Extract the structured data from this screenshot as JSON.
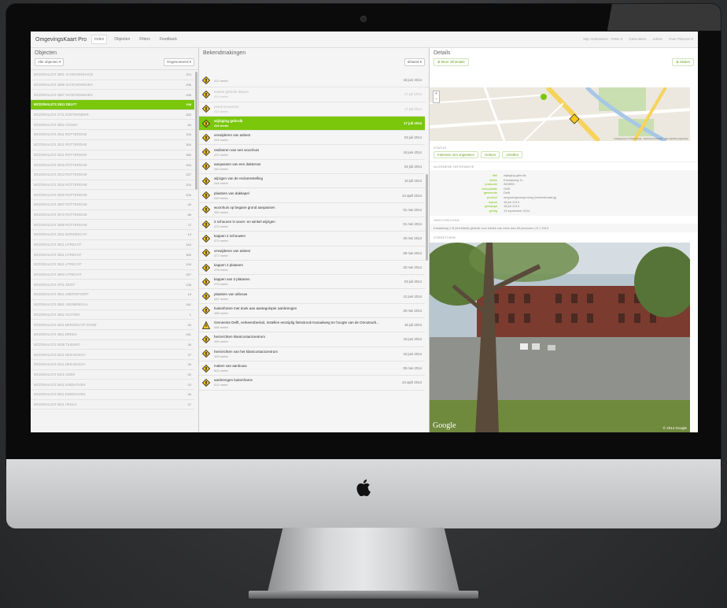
{
  "app": {
    "brand": "OmgevingsKaart Pro",
    "nav": [
      "Index",
      "Objecten",
      "Filters",
      "Feedback"
    ],
    "nav_right": [
      "Mijn Gebruikers · Peter ▾",
      "Gebruikers",
      "Admin",
      "Over Plannen ▾"
    ]
  },
  "objects": {
    "title": "Objecten",
    "filter_label": "Alle objecten ▾",
    "sort_label": "Ongesorteerd ▾",
    "items": [
      {
        "name": "MCDONALD'S 2801 'S-GRAVENHAGE",
        "count": "374"
      },
      {
        "name": "MCDONALD'S 4388 SCHEVENINGEN",
        "count": "296"
      },
      {
        "name": "MCDONALD'S 2587 SCHEVENINGEN",
        "count": "248"
      },
      {
        "name": "MCDONALD'S 2611 DELFT",
        "count": "198",
        "selected": true
      },
      {
        "name": "MCDONALD'S 2711 ZOETERMEER",
        "count": "283"
      },
      {
        "name": "MCDONALD'S 2861 GOUDA",
        "count": "84"
      },
      {
        "name": "MCDONALD'S 3011 ROTTERDAM",
        "count": "194"
      },
      {
        "name": "MCDONALD'S 3011 ROTTERDAM",
        "count": "304"
      },
      {
        "name": "MCDONALD'S 3011 ROTTERDAM",
        "count": "289"
      },
      {
        "name": "MCDONALD'S 3015 ROTTERDAM",
        "count": "154"
      },
      {
        "name": "MCDONALD'S 3013 ROTTERDAM",
        "count": "227"
      },
      {
        "name": "MCDONALD'S 3016 ROTTERDAM",
        "count": "224"
      },
      {
        "name": "MCDONALD'S 3026 ROTTERDAM",
        "count": "226"
      },
      {
        "name": "MCDONALD'S 3087 ROTTERDAM",
        "count": "45"
      },
      {
        "name": "MCDONALD'S 3072 ROTTERDAM",
        "count": "88"
      },
      {
        "name": "MCDONALD'S 3089 ROTTERDAM",
        "count": "72"
      },
      {
        "name": "MCDONALD'S 3311 DORDRECHT",
        "count": "19"
      },
      {
        "name": "MCDONALD'S 3511 UTRECHT",
        "count": "164"
      },
      {
        "name": "MCDONALD'S 3511 UTRECHT",
        "count": "300"
      },
      {
        "name": "MCDONALD'S 3511 UTRECHT",
        "count": "194"
      },
      {
        "name": "MCDONALD'S 3562 UTRECHT",
        "count": "157"
      },
      {
        "name": "MCDONALD'S 3701 ZEIST",
        "count": "136"
      },
      {
        "name": "MCDONALD'S 3811 AMERSFOORT",
        "count": "19"
      },
      {
        "name": "MCDONALD'S 3861 VEENENDAAL",
        "count": "161"
      },
      {
        "name": "MCDONALD'S 4061 OCHTEN",
        "count": "1"
      },
      {
        "name": "MCDONALD'S 4611 BERGEN OP ZOOM",
        "count": "40"
      },
      {
        "name": "MCDONALD'S 4811 BREDA",
        "count": "241"
      },
      {
        "name": "MCDONALD'S 5038 TILBURG",
        "count": "39"
      },
      {
        "name": "MCDONALD'S 5211 DEN BOSCH",
        "count": "37"
      },
      {
        "name": "MCDONALD'S 5211 DEN BOSCH",
        "count": "30"
      },
      {
        "name": "MCDONALD'S 5401 UDEN",
        "count": "32"
      },
      {
        "name": "MCDONALD'S 5611 EINDHOVEN",
        "count": "22"
      },
      {
        "name": "MCDONALD'S 5611 EINDHOVEN",
        "count": "30"
      },
      {
        "name": "MCDONALD'S 5611 VENLO",
        "count": "27"
      }
    ]
  },
  "events": {
    "title": "Bekendmakingen",
    "sort_label": "afstand ▾",
    "items": [
      {
        "title": "",
        "dist": "412 meter",
        "date": "18 juni 2014"
      },
      {
        "title": "inantie gebruik diepen",
        "dist": "414 meter",
        "date": "17 juli 2014",
        "faded": true
      },
      {
        "title": "pand renoveren",
        "dist": "414 meter",
        "date": "17 juli 2014",
        "faded": true
      },
      {
        "title": "wijziging gebruik",
        "dist": "416 meter",
        "date": "17 juli 2014",
        "selected": true
      },
      {
        "title": "verwijderen van asbest",
        "dist": "416 meter",
        "date": "03 juli 2014"
      },
      {
        "title": "realiseren van een woonhuis",
        "dist": "422 meter",
        "date": "18 juni 2014"
      },
      {
        "title": "aanpassen van een dakterras",
        "dist": "440 meter",
        "date": "02 juli 2014"
      },
      {
        "title": "wijzigen van de reclamestelling",
        "dist": "448 meter",
        "date": "10 juli 2014"
      },
      {
        "title": "plaatsen van dakkapel",
        "dist": "449 meter",
        "date": "24 april 2014"
      },
      {
        "title": "woonhuis op begane grond aanpassen",
        "dist": "460 meter",
        "date": "01 mei 2014"
      },
      {
        "title": "2 schuuren in woon- en winkel wijzigen",
        "dist": "470 meter",
        "date": "01 mei 2014"
      },
      {
        "title": "kappen 2 schouwen",
        "dist": "470 meter",
        "date": "20 mei 2014"
      },
      {
        "title": "verwijderen van asbest",
        "dist": "477 meter",
        "date": "09 mei 2014"
      },
      {
        "title": "kappen 2 platanen",
        "dist": "478 meter",
        "date": "20 mei 2014"
      },
      {
        "title": "kappen van 3 platanen",
        "dist": "479 meter",
        "date": "03 juli 2014"
      },
      {
        "title": "plaatsen van uitbouw",
        "dist": "481 meter",
        "date": "12 juni 2014"
      },
      {
        "title": "buitenframe met doek aan aantegoloper aanbrengen",
        "dist": "486 meter",
        "date": "29 mei 2014"
      },
      {
        "title": "Gemeente Delft, verkeersbesluit, instellen eenzijdig fietsstrook Kanaalweg ter hoogte van de Onnotsurb...",
        "dist": "488 meter",
        "date": "18 juli 2014",
        "warn": true
      },
      {
        "title": "herinrichten klantcontactcentrum",
        "dist": "490 meter",
        "date": "10 juni 2014"
      },
      {
        "title": "herinrichten van het klantcontactcentrum",
        "dist": "499 meter",
        "date": "10 juni 2014"
      },
      {
        "title": "maken van aanbouw",
        "dist": "500 meter",
        "date": "09 mei 2014"
      },
      {
        "title": "aanbrengen buitenframe",
        "dist": "511 meter",
        "date": "24 april 2014"
      }
    ]
  },
  "details": {
    "title": "Details",
    "more_info_button": "Meer informatie",
    "close_button": "Sluiten",
    "status_label": "STATUS",
    "status_buttons": [
      "Interesse niet ongeteken",
      "Gebeer",
      "Uitrollen"
    ],
    "general_label": "ALGEMENE INFORMATIE",
    "fields": [
      {
        "key": "titel",
        "value": "wijziging gebruik"
      },
      {
        "key": "adres",
        "value": "Kanaalweg 2c"
      },
      {
        "key": "postcode",
        "value": "2628EB"
      },
      {
        "key": "woonplaats",
        "value": "Delft"
      },
      {
        "key": "gemeente",
        "value": "Delft"
      },
      {
        "key": "product",
        "value": "omgevingsvergunning (bekendmaking)"
      },
      {
        "key": "datum",
        "value": "16 juli 2014"
      },
      {
        "key": "gewijzigd",
        "value": "18 juli 2014"
      },
      {
        "key": "geldig",
        "value": "13 september 2014"
      }
    ],
    "description_label": "OMSCHRIJVING",
    "description": "Kanaalweg 2 B (Herbitekt) gebruik voor kliniek van meer dan 50 personen | 6-7-2014",
    "streetview_label": "STREETVIEW",
    "streetview_brand": "Google",
    "streetview_copyright": "© 2014 Google",
    "map_attribution": "Kaartgegevens ©2014 Google · Gebruiksvoorwaarden · Een kaartfout rapporteren"
  },
  "colors": {
    "accent": "#7ac70c",
    "bezel": "#0b0b0c",
    "aluminium": "#d0d1d3"
  }
}
